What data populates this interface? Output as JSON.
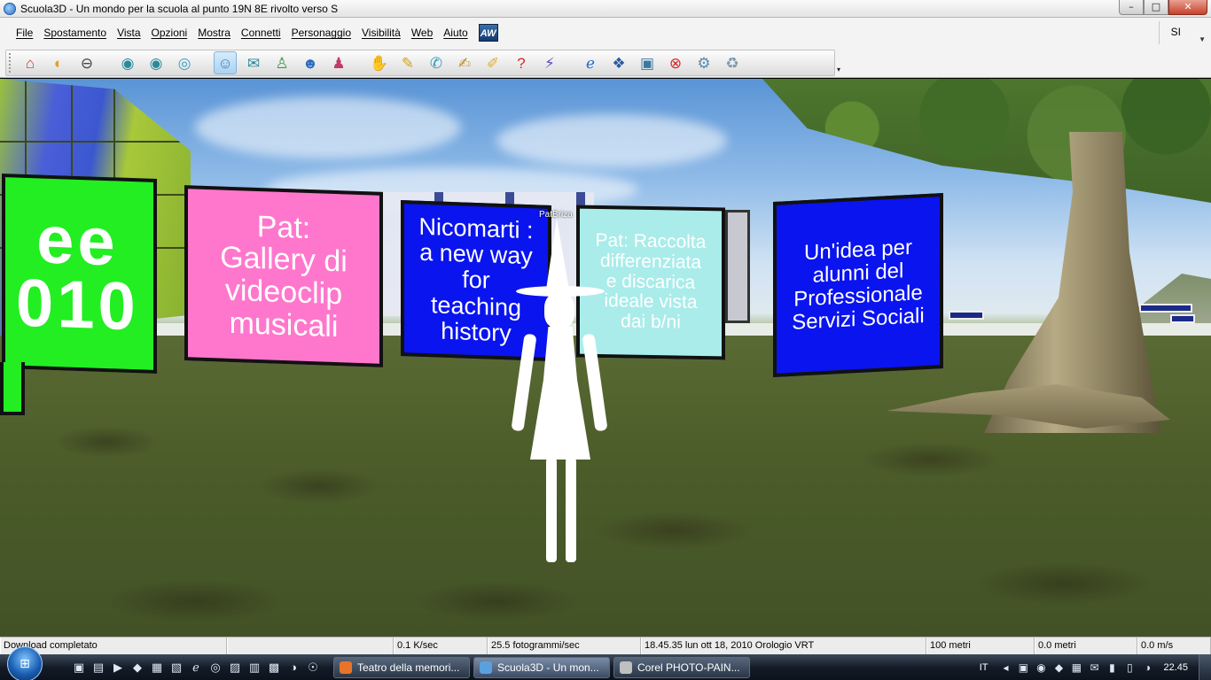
{
  "window": {
    "title": "Scuola3D  - Un mondo per la scuola al punto 19N 8E  rivolto verso S",
    "controls": [
      "–",
      "□",
      "✕"
    ]
  },
  "menubar": {
    "items": [
      "File",
      "Spostamento",
      "Vista",
      "Opzioni",
      "Mostra",
      "Connetti",
      "Personaggio",
      "Visibilità",
      "Web",
      "Aiuto"
    ],
    "logo": "AW",
    "right_item": "SI"
  },
  "toolbar": {
    "groups": [
      [
        "home-icon",
        "back-icon",
        "stop-icon"
      ],
      [
        "eye-icon",
        "eye-alt-icon",
        "eye-rotate-icon"
      ],
      [
        "avatar-icon",
        "telegram-icon",
        "user-icon",
        "users-icon",
        "friends-icon"
      ],
      [
        "gesture-icon",
        "pen-icon",
        "chat-bubble-icon",
        "notepad-icon",
        "edit-icon",
        "question-icon",
        "lightning-icon"
      ],
      [
        "internet-explorer-icon",
        "aw-icon",
        "camera-icon",
        "close-circle-icon",
        "settings-icon",
        "clean-icon"
      ]
    ],
    "glyphs": {
      "home-icon": "⌂",
      "back-icon": "◐",
      "stop-icon": "⊖",
      "eye-icon": "◉",
      "eye-alt-icon": "◉",
      "eye-rotate-icon": "◎",
      "avatar-icon": "☺",
      "telegram-icon": "✉",
      "user-icon": "♙",
      "users-icon": "☻",
      "friends-icon": "♟",
      "gesture-icon": "✋",
      "pen-icon": "✎",
      "chat-bubble-icon": "✆",
      "notepad-icon": "✍",
      "edit-icon": "✐",
      "question-icon": "?",
      "lightning-icon": "⚡",
      "internet-explorer-icon": "ℯ",
      "aw-icon": "❖",
      "camera-icon": "▣",
      "close-circle-icon": "⊗",
      "settings-icon": "⚙",
      "clean-icon": "♻"
    },
    "colors": {
      "home-icon": "#c0392b",
      "back-icon": "#e0a020",
      "stop-icon": "#444444",
      "eye-icon": "#2a8a9a",
      "eye-alt-icon": "#2a8a9a",
      "eye-rotate-icon": "#3aa0c0",
      "avatar-icon": "#3a78c0",
      "telegram-icon": "#2a8aa0",
      "user-icon": "#3a9a4a",
      "users-icon": "#2a6ac0",
      "friends-icon": "#c03a6a",
      "gesture-icon": "#d08a20",
      "pen-icon": "#d0a020",
      "chat-bubble-icon": "#2a9ac0",
      "notepad-icon": "#c09030",
      "edit-icon": "#e0b020",
      "question-icon": "#d02a2a",
      "lightning-icon": "#6a4ac0",
      "internet-explorer-icon": "#1a6ad0",
      "aw-icon": "#2a5aa0",
      "camera-icon": "#3a7aa0",
      "close-circle-icon": "#d02a2a",
      "settings-icon": "#5a8ab0",
      "clean-icon": "#7a9ab0"
    },
    "active": "avatar-icon",
    "more": "▾"
  },
  "scene": {
    "signs": {
      "green": "ee\n010",
      "pink": "Pat:\nGallery di\nvideoclip\nmusicali",
      "blue1": "Nicomarti :\na new way\nfor\nteaching\nhistory",
      "cyan": "Pat: Raccolta\ndifferenziata\ne discarica\nideale vista\ndai b/ni",
      "blue2": "Un'idea per\nalunni del\nProfessionale\nServizi Sociali"
    },
    "avatar_name": "PatBriza"
  },
  "statusbar": {
    "cells": [
      {
        "text": "Download completato",
        "width": 256
      },
      {
        "text": "",
        "width": 188
      },
      {
        "text": "0.1 K/sec",
        "width": 106
      },
      {
        "text": "25.5 fotogrammi/sec",
        "width": 173
      },
      {
        "text": "18.45.35 lun ott 18, 2010 Orologio VRT",
        "width": 322
      },
      {
        "text": "100 metri",
        "width": 122
      },
      {
        "text": "0.0 metri",
        "width": 116
      },
      {
        "text": "0.0 m/s",
        "width": 83
      }
    ]
  },
  "taskbar": {
    "quicklaunch": [
      "▣",
      "▤",
      "▶",
      "◆",
      "▦",
      "▧",
      "ℯ",
      "◎",
      "▨",
      "▥",
      "▩",
      "◑",
      "☉"
    ],
    "tasks": [
      {
        "label": "Teatro della memori...",
        "width": 154,
        "color": "#e8742a",
        "active": false
      },
      {
        "label": "Scuola3D  - Un mon...",
        "width": 154,
        "color": "#5aa0e0",
        "active": true
      },
      {
        "label": "Corel PHOTO-PAIN...",
        "width": 154,
        "color": "#c0c0c0",
        "active": false
      }
    ],
    "language": "IT",
    "tray_icons": [
      "◂",
      "▣",
      "◉",
      "◆",
      "▦",
      "✉",
      "▮",
      "▯",
      "◑"
    ],
    "clock": "22.45"
  }
}
